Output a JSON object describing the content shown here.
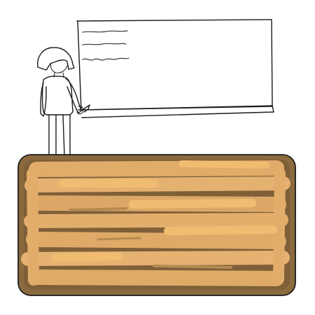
{
  "colors": {
    "ink": "#1a1a1a",
    "paper": "#ffffff",
    "desk_base": "#8a6a3e",
    "desk_fill": "#e0ac6a",
    "desk_highlight": "#f0bc72",
    "desk_shadow": "#6f5330"
  },
  "icons": {
    "whiteboard": "whiteboard-icon",
    "teacher": "teacher-figure-icon",
    "pointer": "pointer-stick-icon",
    "desk": "desk-icon"
  }
}
